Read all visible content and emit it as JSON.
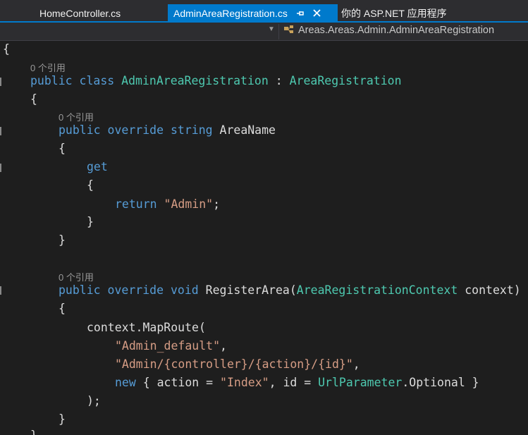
{
  "tabs": [
    {
      "label": "HomeController.cs",
      "active": false
    },
    {
      "label": "AdminAreaRegistration.cs",
      "active": true,
      "pin_icon": "pin-icon",
      "close_icon": "close-icon"
    },
    {
      "label": "你的 ASP.NET 应用程序",
      "active": false
    }
  ],
  "navbar": {
    "member": "Areas.Areas.Admin.AdminAreaRegistration",
    "icon": "class-icon"
  },
  "code": {
    "brace_open_1": "{",
    "ref_1": "0 个引用",
    "l_public": "public",
    "l_class": "class",
    "l_classname": "AdminAreaRegistration",
    "l_colon": " : ",
    "l_base": "AreaRegistration",
    "brace_open_2": "{",
    "ref_2": "0 个引用",
    "p_public": "public",
    "p_override": "override",
    "p_string": "string",
    "p_name": "AreaName",
    "brace_open_3": "{",
    "get": "get",
    "brace_open_4": "{",
    "ret": "return",
    "ret_val": "\"Admin\"",
    "semi": ";",
    "brace_close_4": "}",
    "brace_close_3": "}",
    "ref_3": "0 个引用",
    "m_public": "public",
    "m_override": "override",
    "m_void": "void",
    "m_name": "RegisterArea(",
    "m_ptype": "AreaRegistrationContext",
    "m_pname": " context)",
    "brace_open_5": "{",
    "map_call": "context.MapRoute(",
    "arg1": "\"Admin_default\"",
    "comma": ",",
    "arg2": "\"Admin/{controller}/{action}/{id}\"",
    "new_kw": "new",
    "anon_open": " { action = ",
    "index": "\"Index\"",
    "id_part": ", id = ",
    "url_type": "UrlParameter",
    "optional": ".Optional }",
    "close_call": ");",
    "brace_close_5": "}",
    "brace_close_2": "}"
  },
  "colors": {
    "keyword": "#569cd6",
    "type": "#4ec9b0",
    "string": "#d69d85",
    "accent": "#007acc"
  }
}
